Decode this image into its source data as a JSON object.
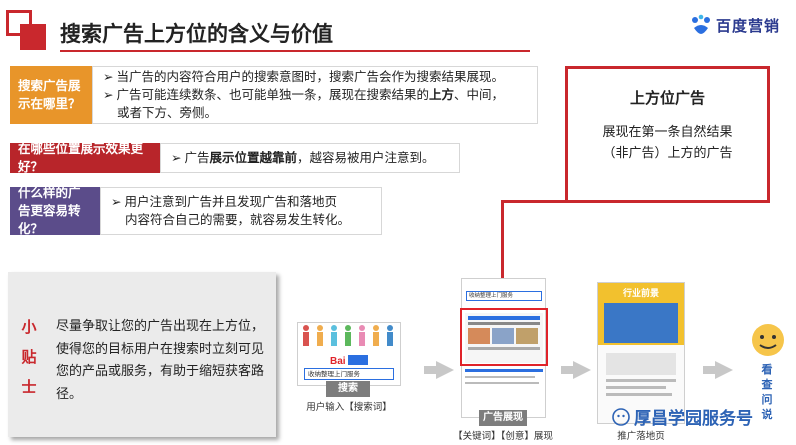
{
  "header": {
    "title": "搜索广告上方位的含义与价值",
    "brand_text": "百度营销"
  },
  "rows": [
    {
      "tag": "搜索广告展示在哪里？",
      "lines": [
        {
          "pre": "当广告的内容符合用户的搜索意图时，搜索广告会作为搜索结果展现。",
          "bold": "",
          "post": ""
        },
        {
          "pre": "广告可能连续数条、也可能单独一条，展现在搜索结果的",
          "bold": "上方",
          "post": "、中间，"
        },
        {
          "pre": "或者下方、旁侧。",
          "bold": "",
          "post": ""
        }
      ]
    },
    {
      "tag": "在哪些位置展示效果更好？",
      "lines": [
        {
          "pre": "广告",
          "bold": "展示位置越靠前",
          "post": "，越容易被用户注意到。"
        }
      ]
    },
    {
      "tag": "什么样的广告更容易转化？",
      "lines": [
        {
          "pre": "用户注意到广告并且发现广告和落地页",
          "bold": "",
          "post": ""
        },
        {
          "pre": "内容符合自己的需要，就容易发生转化。",
          "bold": "",
          "post": ""
        }
      ]
    }
  ],
  "callout": {
    "title": "上方位广告",
    "body_line1": "展现在第一条自然结果",
    "body_line2": "（非广告）上方的广告"
  },
  "tips": {
    "label": "小贴士",
    "text": "尽量争取让您的广告出现在上方位，使得您的目标用户在搜索时立刻可见您的产品或服务，有助于缩短获客路径。"
  },
  "flow": {
    "step1_button": "搜索",
    "step1_caption": "用户输入【搜索词】",
    "step1_search_text": "收纳整理上门服务",
    "step2_button": "广告展现",
    "step2_caption": "【关键词】【创意】展现",
    "step2_search_text": "收纳整理上门服务",
    "step3_banner": "行业前景",
    "step3_caption": "推广落地页",
    "step4_text": "看查问说"
  },
  "watermark": {
    "text": "厚昌学园服务号"
  },
  "colors": {
    "accent_red": "#c9282d",
    "tag_orange": "#e8952a",
    "tag_red": "#b8252a",
    "tag_purple": "#5b4c8a",
    "brand_blue": "#2b3a8f"
  }
}
